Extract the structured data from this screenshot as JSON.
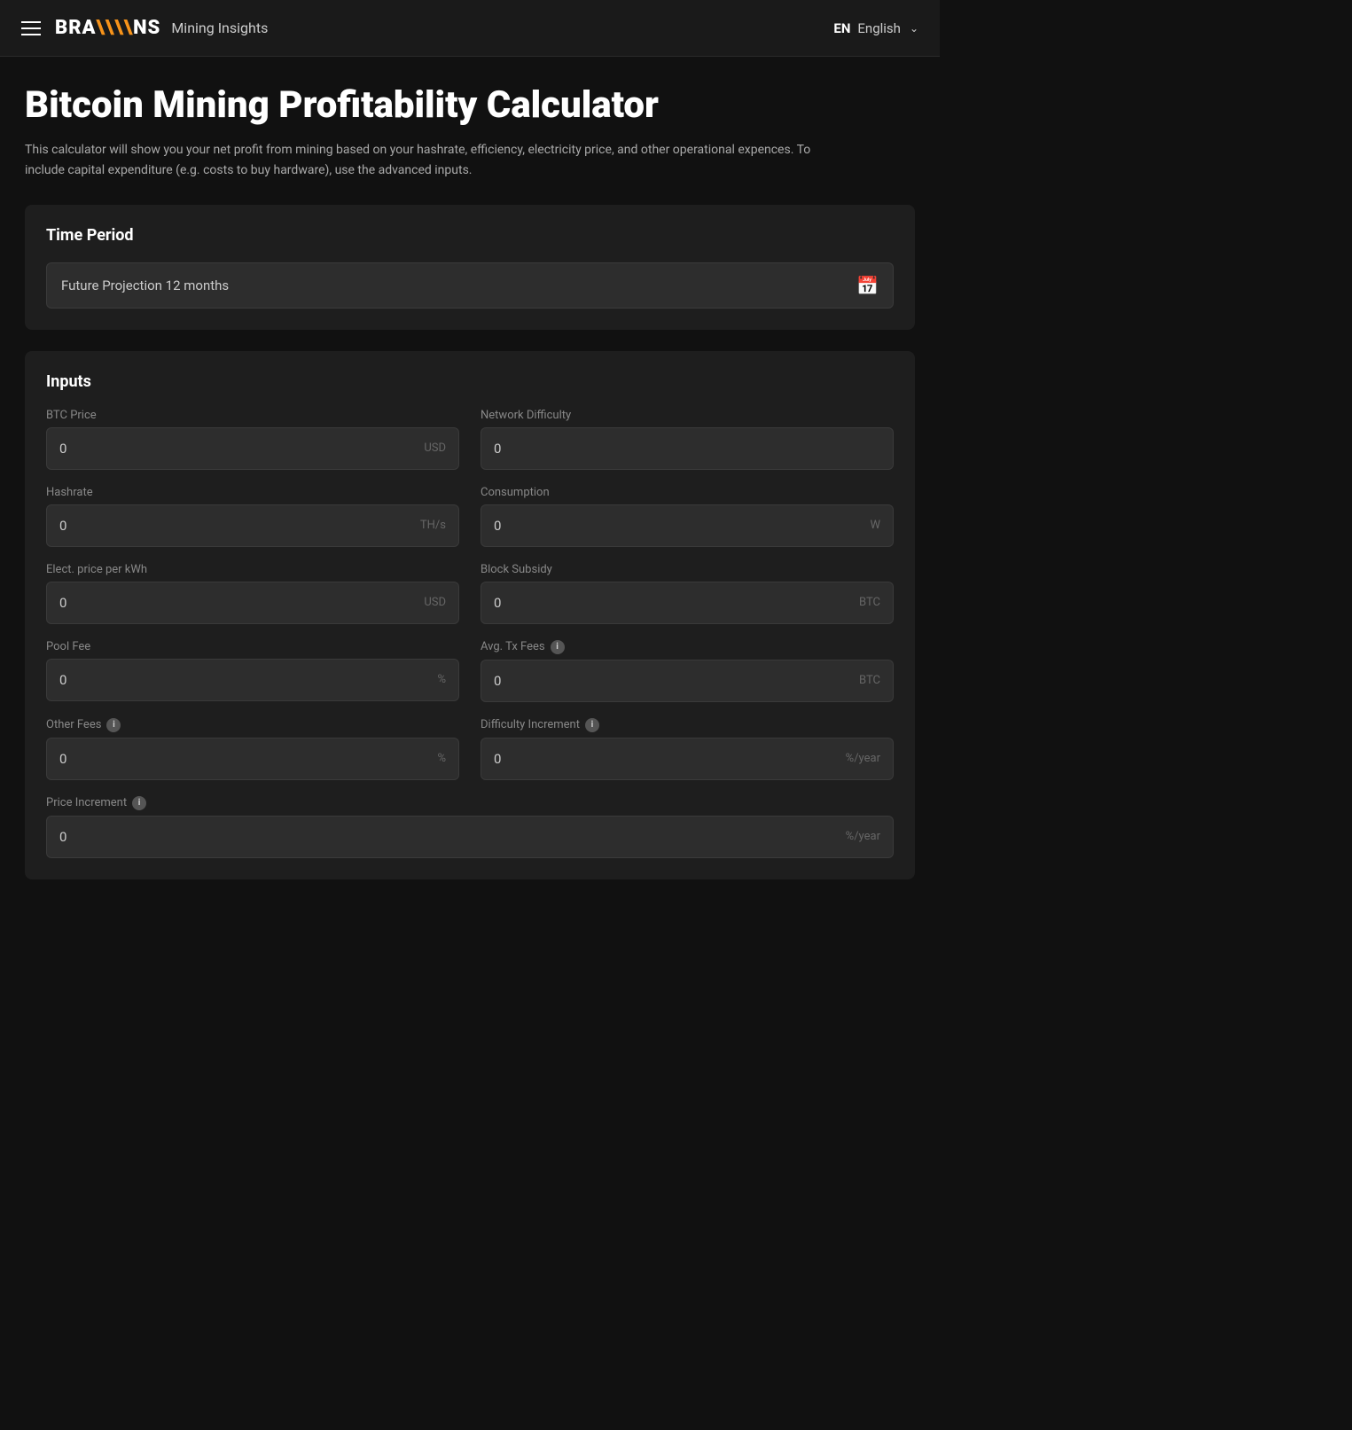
{
  "navbar": {
    "hamburger_label": "menu",
    "brand_logo": "BRA\\\\NS",
    "brand_subtitle": "Mining Insights",
    "language_code": "EN",
    "language_label": "English",
    "language_chevron": "∨"
  },
  "page": {
    "title": "Bitcoin Mining Profitability Calculator",
    "description": "This calculator will show you your net profit from mining based on your hashrate, efficiency, electricity price, and other operational expences. To include capital expenditure (e.g. costs to buy hardware), use the advanced inputs."
  },
  "time_period": {
    "section_title": "Time Period",
    "selected_value": "Future Projection 12 months",
    "calendar_icon": "📅"
  },
  "inputs": {
    "section_title": "Inputs",
    "fields": [
      {
        "id": "btc-price",
        "label": "BTC Price",
        "value": "0",
        "unit": "USD",
        "has_info": false,
        "column": "left"
      },
      {
        "id": "network-difficulty",
        "label": "Network Difficulty",
        "value": "0",
        "unit": "",
        "has_info": false,
        "column": "right"
      },
      {
        "id": "hashrate",
        "label": "Hashrate",
        "value": "0",
        "unit": "TH/s",
        "has_info": false,
        "column": "left"
      },
      {
        "id": "consumption",
        "label": "Consumption",
        "value": "0",
        "unit": "W",
        "has_info": false,
        "column": "right"
      },
      {
        "id": "elect-price",
        "label": "Elect. price per kWh",
        "value": "0",
        "unit": "USD",
        "has_info": false,
        "column": "left"
      },
      {
        "id": "block-subsidy",
        "label": "Block Subsidy",
        "value": "0",
        "unit": "BTC",
        "has_info": false,
        "column": "right"
      },
      {
        "id": "pool-fee",
        "label": "Pool Fee",
        "value": "0",
        "unit": "%",
        "has_info": false,
        "column": "left"
      },
      {
        "id": "avg-tx-fees",
        "label": "Avg. Tx Fees",
        "value": "0",
        "unit": "BTC",
        "has_info": true,
        "column": "right"
      },
      {
        "id": "other-fees",
        "label": "Other Fees",
        "value": "0",
        "unit": "%",
        "has_info": true,
        "column": "left"
      },
      {
        "id": "difficulty-increment",
        "label": "Difficulty Increment",
        "value": "0",
        "unit": "%/year",
        "has_info": true,
        "column": "right"
      },
      {
        "id": "price-increment",
        "label": "Price Increment",
        "value": "0",
        "unit": "%/year",
        "has_info": true,
        "column": "full"
      }
    ],
    "info_icon_label": "i"
  }
}
